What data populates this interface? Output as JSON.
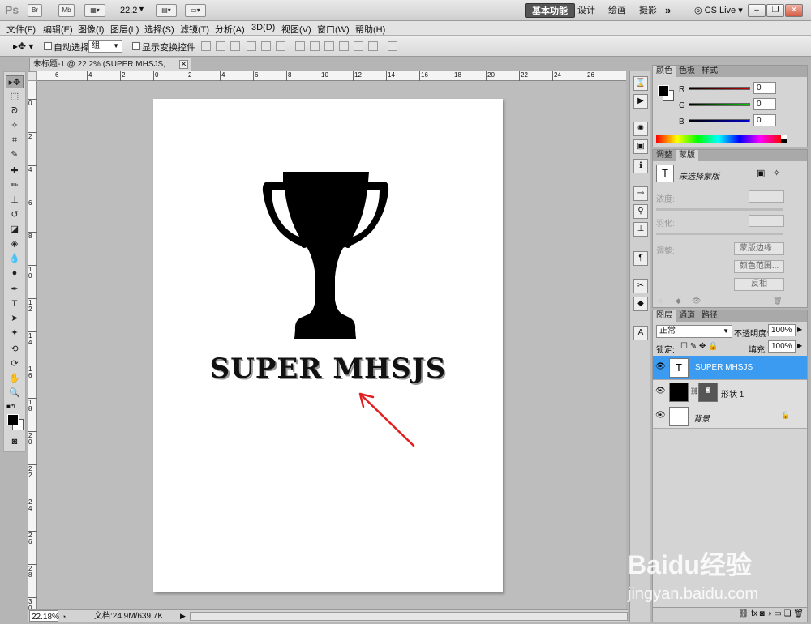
{
  "app": {
    "logo": "Ps",
    "zoom_display": "22.2",
    "workspaces": [
      "基本功能",
      "设计",
      "绘画",
      "摄影"
    ],
    "more": "»",
    "cs_live": "CS Live"
  },
  "menu": [
    "文件(F)",
    "编辑(E)",
    "图像(I)",
    "图层(L)",
    "选择(S)",
    "滤镜(T)",
    "分析(A)",
    "3D(D)",
    "视图(V)",
    "窗口(W)",
    "帮助(H)"
  ],
  "options": {
    "auto_select": "自动选择:",
    "auto_select_value": "组",
    "show_transform": "显示变换控件"
  },
  "document": {
    "tab_title": "未标题-1 @ 22.2% (SUPER MHSJS, RGB/8) *",
    "artwork_text": "SUPER MHSJS"
  },
  "rulers": {
    "h": [
      "6",
      "4",
      "2",
      "0",
      "2",
      "4",
      "6",
      "8",
      "10",
      "12",
      "14",
      "16",
      "18",
      "20",
      "22",
      "24",
      "26"
    ],
    "v": [
      "0",
      "2",
      "4",
      "6",
      "8",
      "1 0",
      "1 2",
      "1 4",
      "1 6",
      "1 8",
      "2 0",
      "2 2",
      "2 4",
      "2 6",
      "2 8",
      "3 0"
    ]
  },
  "status": {
    "zoom": "22.18%",
    "doc": "文档:24.9M/639.7K"
  },
  "color_panel": {
    "tabs": [
      "颜色",
      "色板",
      "样式"
    ],
    "channels": [
      {
        "label": "R",
        "value": "0",
        "color": "#cc0000"
      },
      {
        "label": "G",
        "value": "0",
        "color": "#00aa00"
      },
      {
        "label": "B",
        "value": "0",
        "color": "#0000cc"
      }
    ]
  },
  "masks_panel": {
    "tabs": [
      "调整",
      "蒙版"
    ],
    "no_mask": "未选择蒙版",
    "density": "浓度:",
    "feather": "羽化:",
    "refine": "调整:",
    "btn_edge": "蒙版边缘...",
    "btn_range": "颜色范围...",
    "btn_invert": "反相"
  },
  "layers_panel": {
    "tabs": [
      "图层",
      "通道",
      "路径"
    ],
    "blend": "正常",
    "opacity_label": "不透明度:",
    "opacity": "100%",
    "lock_label": "锁定:",
    "fill_label": "填充:",
    "fill": "100%",
    "layers": [
      {
        "name": "SUPER MHSJS",
        "thumb": "T"
      },
      {
        "name": "形状 1"
      },
      {
        "name": "背景"
      }
    ]
  },
  "watermark": {
    "brand": "Baidu经验",
    "url": "jingyan.baidu.com"
  },
  "colors": {
    "accent": "#3a9bf0",
    "arrow": "#e02020"
  }
}
